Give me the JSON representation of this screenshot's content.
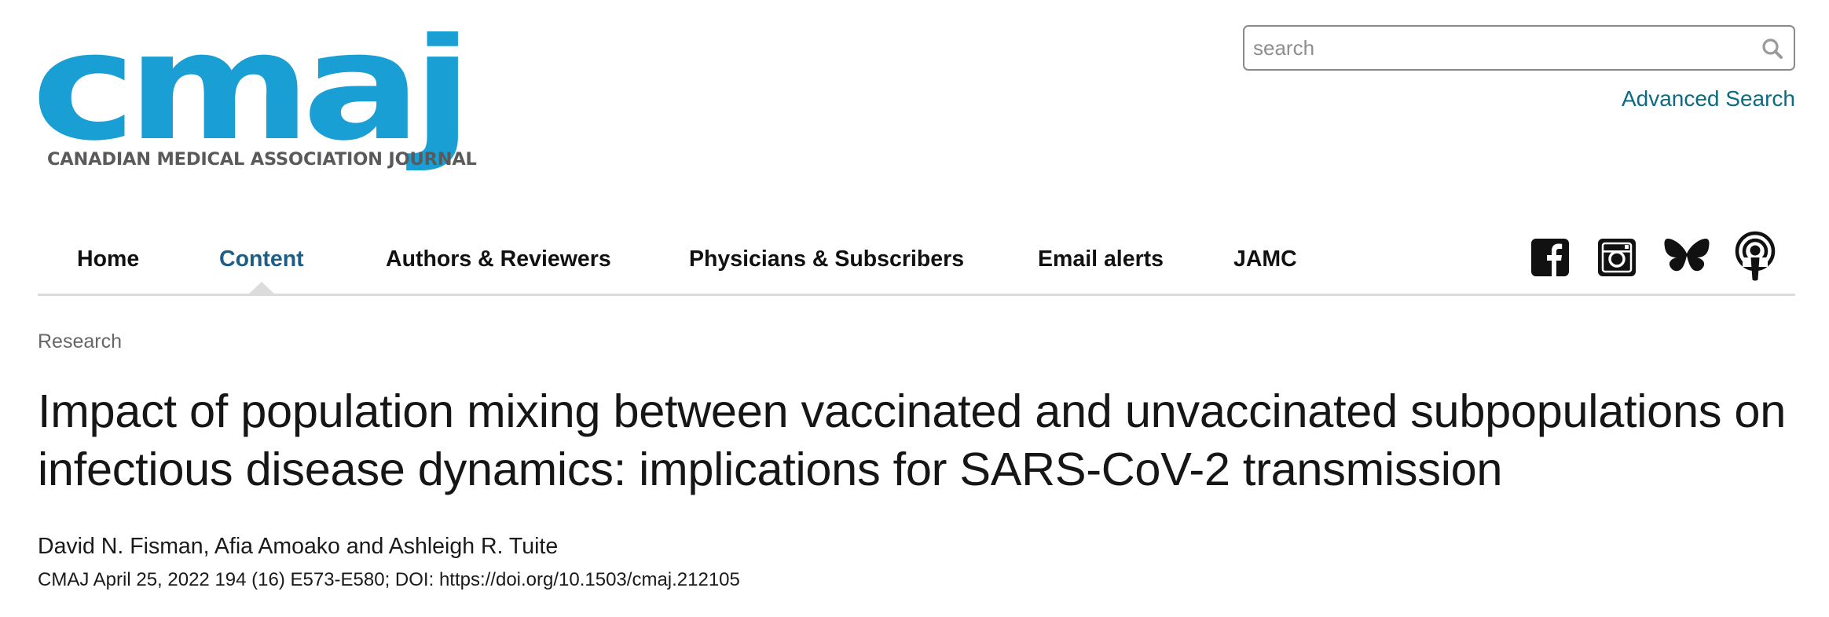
{
  "logo": {
    "wordmark": "cmaj",
    "tagline": "CANADIAN MEDICAL ASSOCIATION JOURNAL",
    "color": "#1a9fd4"
  },
  "search": {
    "placeholder": "search",
    "value": "",
    "icon": "search-icon",
    "advanced_label": "Advanced Search"
  },
  "nav": {
    "active": "Content",
    "items": [
      {
        "label": "Home"
      },
      {
        "label": "Content"
      },
      {
        "label": "Authors & Reviewers"
      },
      {
        "label": "Physicians & Subscribers"
      },
      {
        "label": "Email alerts"
      },
      {
        "label": "JAMC"
      }
    ],
    "active_color": "#1e5d85"
  },
  "social": [
    {
      "icon": "facebook-icon"
    },
    {
      "icon": "instagram-icon"
    },
    {
      "icon": "bluesky-icon"
    },
    {
      "icon": "podcast-icon"
    }
  ],
  "article": {
    "section": "Research",
    "title": "Impact of population mixing between vaccinated and unvaccinated subpopulations on infectious disease dynamics: implications for SARS-CoV-2 transmission",
    "authors": "David N. Fisman, Afia Amoako and Ashleigh R. Tuite",
    "citation": "CMAJ April 25, 2022 194 (16) E573-E580; DOI: https://doi.org/10.1503/cmaj.212105"
  },
  "colors": {
    "link": "#0c6a82",
    "rule": "#dcdcdc"
  }
}
